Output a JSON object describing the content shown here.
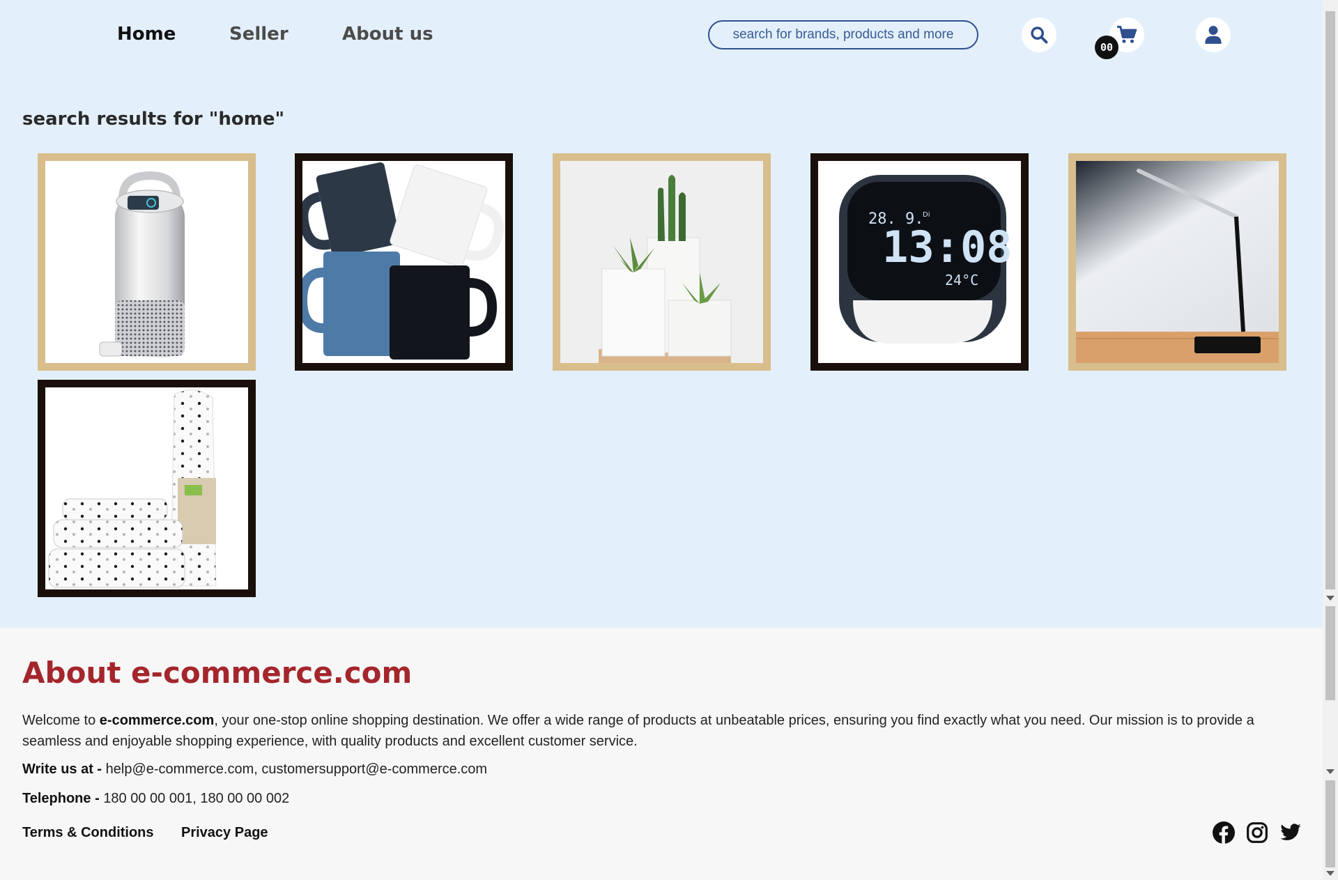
{
  "nav": {
    "home": "Home",
    "seller": "Seller",
    "about": "About us"
  },
  "search": {
    "placeholder": "search for brands, products and more"
  },
  "cart": {
    "count": "00"
  },
  "icons": {
    "search": "search-icon",
    "cart": "cart-icon",
    "user": "user-icon",
    "facebook": "facebook-icon",
    "instagram": "instagram-icon",
    "twitter": "twitter-icon"
  },
  "results": {
    "title": "search results for \"home\"",
    "products": [
      {
        "image": "air-purifier",
        "frame": "tan"
      },
      {
        "image": "mugs",
        "frame": "dark"
      },
      {
        "image": "succulent-planters",
        "frame": "tan"
      },
      {
        "image": "digital-alarm-clock",
        "frame": "dark"
      },
      {
        "image": "desk-lamp",
        "frame": "tan"
      },
      {
        "image": "polka-dot-bedsheets",
        "frame": "dark"
      }
    ]
  },
  "clock": {
    "date": "28. 9.",
    "day": "Di",
    "time": "13:08",
    "temp": "24°C"
  },
  "footer": {
    "title": "About e-commerce.com",
    "welcome_prefix": "Welcome to ",
    "brand": "e-commerce.com",
    "welcome_rest": ", your one-stop online shopping destination. We offer a wide range of products at unbeatable prices, ensuring you find exactly what you need. Our mission is to provide a seamless and enjoyable shopping experience, with quality products and excellent customer service.",
    "write_label": "Write us at - ",
    "write_value": "help@e-commerce.com, customersupport@e-commerce.com",
    "phone_label": "Telephone - ",
    "phone_value": "180 00 00 001, 180 00 00 002",
    "terms": "Terms & Conditions",
    "privacy": "Privacy Page"
  },
  "colors": {
    "background": "#e3f0fb",
    "accent": "#a4262c",
    "nav_blue": "#2f4f8f",
    "tan_frame": "#d7be8c",
    "dark_frame": "#1a0f0a"
  }
}
